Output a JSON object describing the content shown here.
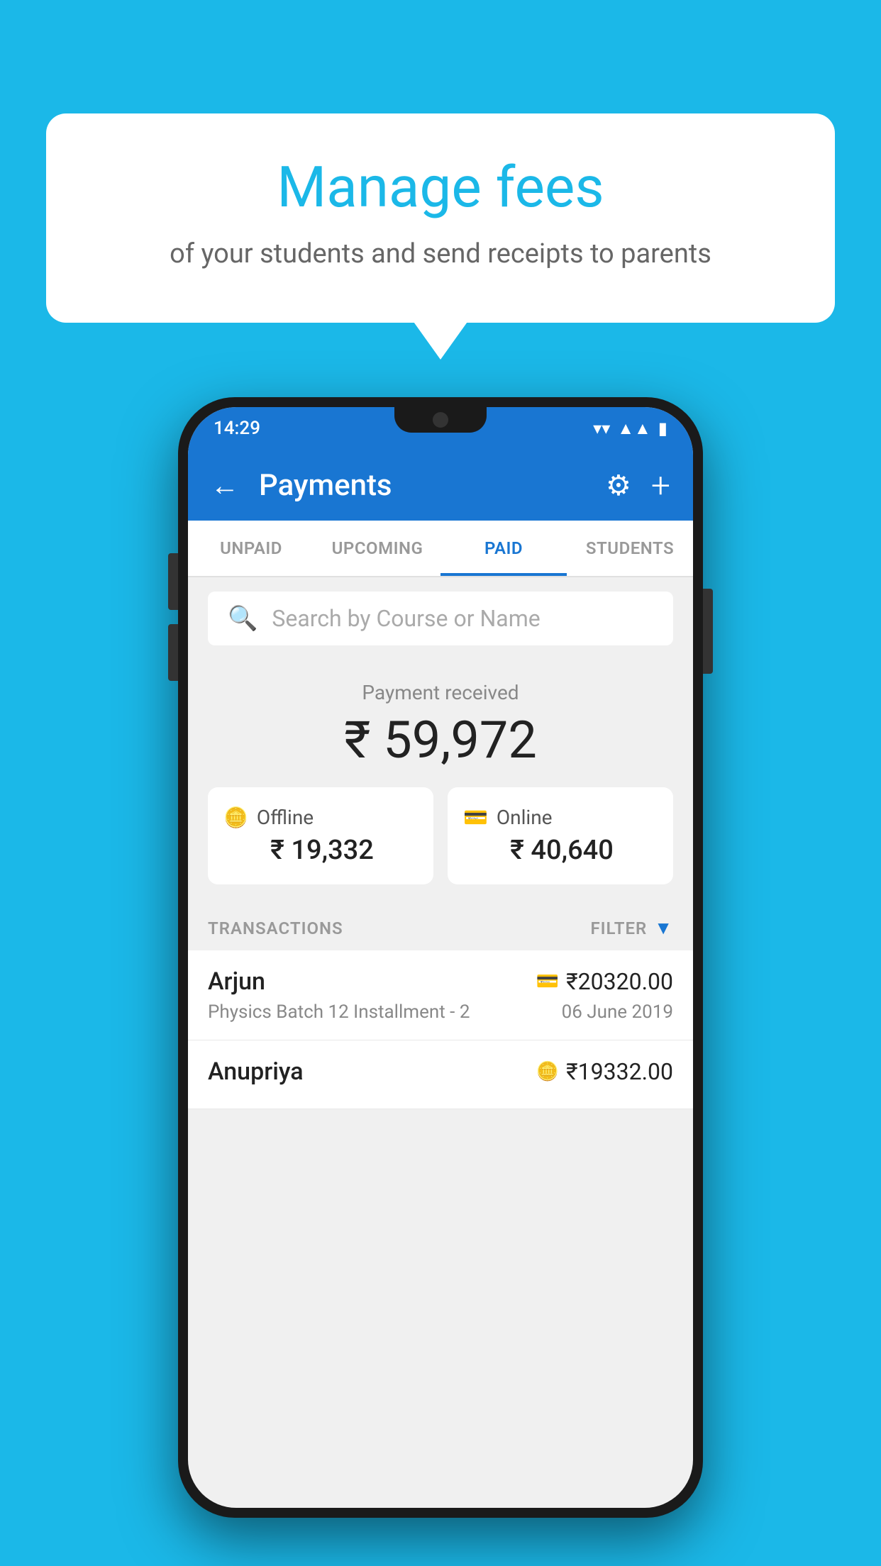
{
  "page": {
    "background_color": "#1bb8e8"
  },
  "bubble": {
    "title": "Manage fees",
    "subtitle": "of your students and send receipts to parents"
  },
  "status_bar": {
    "time": "14:29",
    "wifi": "▲",
    "signal": "▲",
    "battery": "▮"
  },
  "app_bar": {
    "title": "Payments",
    "back_label": "←",
    "gear_label": "⚙",
    "plus_label": "+"
  },
  "tabs": [
    {
      "id": "unpaid",
      "label": "UNPAID",
      "active": false
    },
    {
      "id": "upcoming",
      "label": "UPCOMING",
      "active": false
    },
    {
      "id": "paid",
      "label": "PAID",
      "active": true
    },
    {
      "id": "students",
      "label": "STUDENTS",
      "active": false
    }
  ],
  "search": {
    "placeholder": "Search by Course or Name"
  },
  "payment_summary": {
    "label": "Payment received",
    "total_amount": "₹ 59,972",
    "offline": {
      "label": "Offline",
      "amount": "₹ 19,332"
    },
    "online": {
      "label": "Online",
      "amount": "₹ 40,640"
    }
  },
  "transactions": {
    "section_label": "TRANSACTIONS",
    "filter_label": "FILTER",
    "rows": [
      {
        "name": "Arjun",
        "course": "Physics Batch 12 Installment - 2",
        "amount": "₹20320.00",
        "date": "06 June 2019",
        "type": "online"
      },
      {
        "name": "Anupriya",
        "course": "",
        "amount": "₹19332.00",
        "date": "",
        "type": "offline"
      }
    ]
  }
}
